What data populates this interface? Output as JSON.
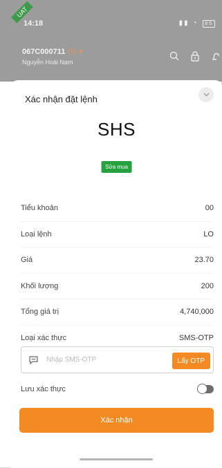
{
  "status_bar": {
    "time": "14:18",
    "env_tag": "UAT",
    "icons": "‡ ☷",
    "battery": "85"
  },
  "app_header": {
    "account_number": "067C000711",
    "sub_account": "00 ▾",
    "account_name": "Nguyễn Hoài Nam",
    "icons": [
      "search-icon",
      "lock-icon",
      "bell-icon"
    ]
  },
  "modal": {
    "title": "Xác nhận đặt lệnh",
    "symbol": "SHS",
    "action_label": "Sửa mua",
    "rows": [
      {
        "label": "Tiểu khoản",
        "value": "00"
      },
      {
        "label": "Loại lệnh",
        "value": "LO"
      },
      {
        "label": "Giá",
        "value": "23.70"
      },
      {
        "label": "Khối lượng",
        "value": "200"
      },
      {
        "label": "Tổng giá trị",
        "value": "4,740,000"
      },
      {
        "label": "Loại xác thực",
        "value": "SMS-OTP"
      }
    ],
    "otp": {
      "placeholder": "Nhập SMS-OTP",
      "value": "",
      "get_otp_label": "Lấy OTP"
    },
    "save_auth_label": "Lưu xác thực",
    "save_auth_enabled": false,
    "confirm_label": "Xác nhận"
  },
  "colors": {
    "accent": "#f38a24",
    "action_badge": "#26a13f",
    "overlay_header": "#9c9c9c"
  }
}
